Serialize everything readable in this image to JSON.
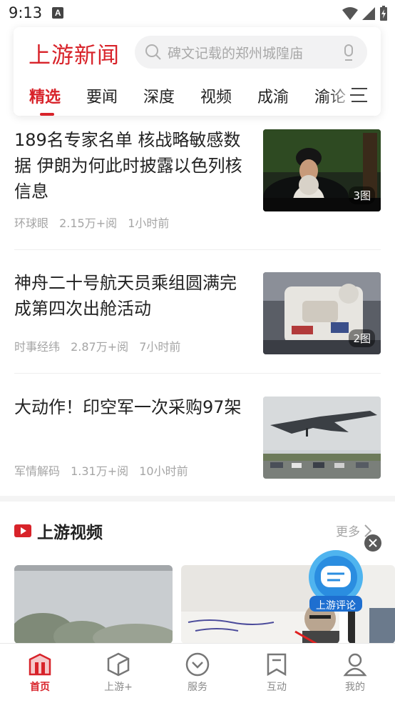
{
  "status_bar": {
    "time": "9:13",
    "notif_letter": "A"
  },
  "header": {
    "logo": "上游新闻",
    "search": {
      "placeholder": "碑文记载的郑州城隍庙"
    },
    "tabs": [
      {
        "label": "精选",
        "active": true
      },
      {
        "label": "要闻"
      },
      {
        "label": "深度"
      },
      {
        "label": "视频"
      },
      {
        "label": "成渝"
      },
      {
        "label": "渝论"
      }
    ]
  },
  "news": [
    {
      "title": "189名专家名单 核战略敏感数据 伊朗为何此时披露以色列核信息",
      "source": "环球眼",
      "views": "2.15万+阅",
      "time": "1小时前",
      "badge": "3图"
    },
    {
      "title": "神舟二十号航天员乘组圆满完成第四次出舱活动",
      "source": "时事经纬",
      "views": "2.87万+阅",
      "time": "7小时前",
      "badge": "2图"
    },
    {
      "title": "大动作！印空军一次采购97架",
      "source": "军情解码",
      "views": "1.31万+阅",
      "time": "10小时前",
      "badge": ""
    }
  ],
  "video_section": {
    "title": "上游视频",
    "more": "更多",
    "floating_badge": "上游评论"
  },
  "bottom_nav": [
    {
      "label": "首页",
      "icon": "home-icon",
      "active": true
    },
    {
      "label": "上游+",
      "icon": "cube-icon"
    },
    {
      "label": "服务",
      "icon": "chevron-circle-icon"
    },
    {
      "label": "互动",
      "icon": "bookmark-icon"
    },
    {
      "label": "我的",
      "icon": "person-icon"
    }
  ],
  "colors": {
    "brand_red": "#d8232a",
    "muted": "#a5a5a5"
  }
}
